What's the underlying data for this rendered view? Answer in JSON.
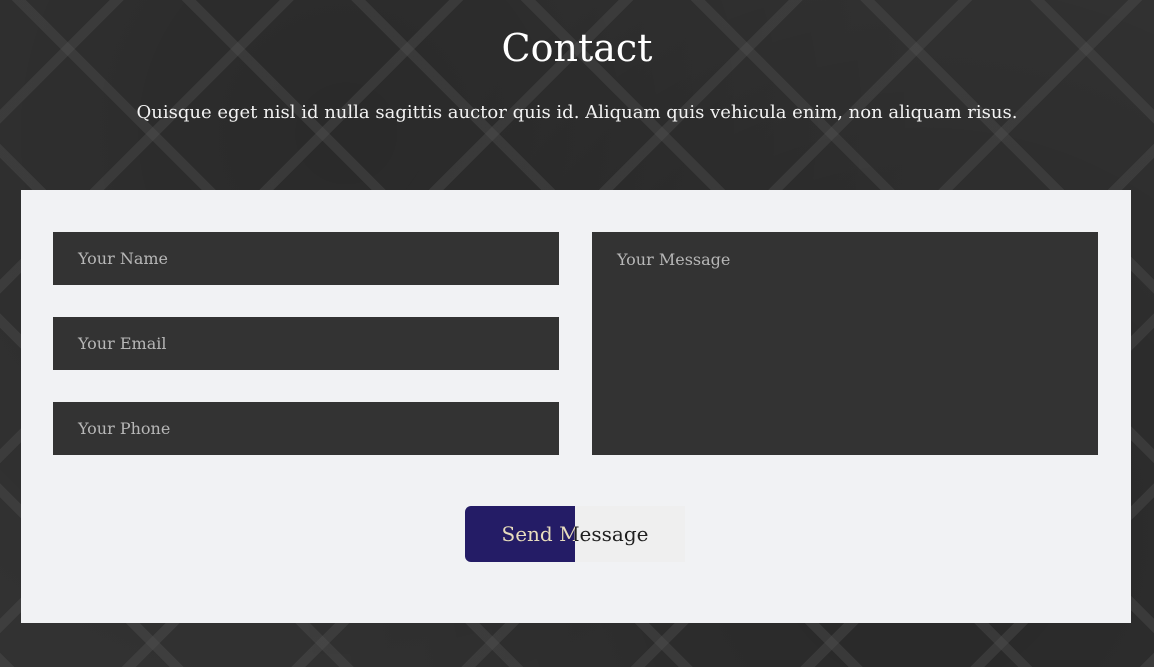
{
  "section": {
    "title": "Contact",
    "subtitle": "Quisque eget nisl id nulla sagittis auctor quis id. Aliquam quis vehicula enim, non aliquam risus."
  },
  "form": {
    "name_placeholder": "Your Name",
    "email_placeholder": "Your Email",
    "phone_placeholder": "Your Phone",
    "message_placeholder": "Your Message",
    "submit_label": "Send Message"
  },
  "colors": {
    "field_background": "#333333",
    "panel_background": "#f1f2f4",
    "button_primary": "#241c66",
    "button_secondary": "#efefef"
  }
}
